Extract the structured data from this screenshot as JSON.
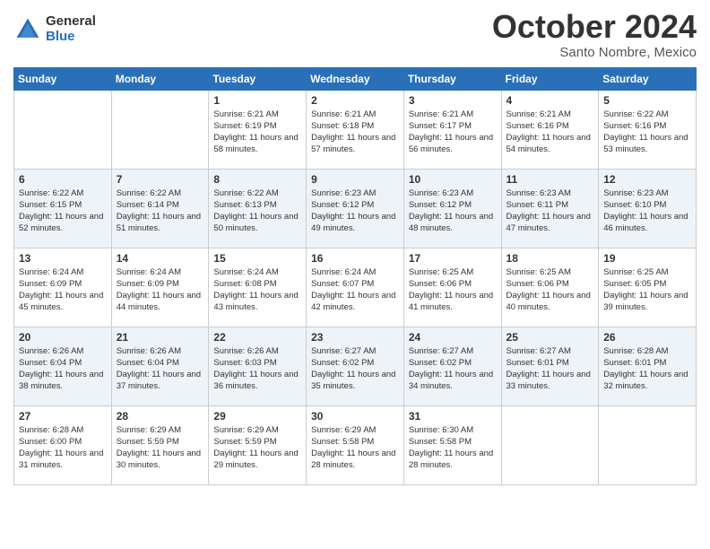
{
  "header": {
    "logo_general": "General",
    "logo_blue": "Blue",
    "month_title": "October 2024",
    "subtitle": "Santo Nombre, Mexico"
  },
  "weekdays": [
    "Sunday",
    "Monday",
    "Tuesday",
    "Wednesday",
    "Thursday",
    "Friday",
    "Saturday"
  ],
  "weeks": [
    [
      {
        "day": "",
        "info": ""
      },
      {
        "day": "",
        "info": ""
      },
      {
        "day": "1",
        "info": "Sunrise: 6:21 AM\nSunset: 6:19 PM\nDaylight: 11 hours and 58 minutes."
      },
      {
        "day": "2",
        "info": "Sunrise: 6:21 AM\nSunset: 6:18 PM\nDaylight: 11 hours and 57 minutes."
      },
      {
        "day": "3",
        "info": "Sunrise: 6:21 AM\nSunset: 6:17 PM\nDaylight: 11 hours and 56 minutes."
      },
      {
        "day": "4",
        "info": "Sunrise: 6:21 AM\nSunset: 6:16 PM\nDaylight: 11 hours and 54 minutes."
      },
      {
        "day": "5",
        "info": "Sunrise: 6:22 AM\nSunset: 6:16 PM\nDaylight: 11 hours and 53 minutes."
      }
    ],
    [
      {
        "day": "6",
        "info": "Sunrise: 6:22 AM\nSunset: 6:15 PM\nDaylight: 11 hours and 52 minutes."
      },
      {
        "day": "7",
        "info": "Sunrise: 6:22 AM\nSunset: 6:14 PM\nDaylight: 11 hours and 51 minutes."
      },
      {
        "day": "8",
        "info": "Sunrise: 6:22 AM\nSunset: 6:13 PM\nDaylight: 11 hours and 50 minutes."
      },
      {
        "day": "9",
        "info": "Sunrise: 6:23 AM\nSunset: 6:12 PM\nDaylight: 11 hours and 49 minutes."
      },
      {
        "day": "10",
        "info": "Sunrise: 6:23 AM\nSunset: 6:12 PM\nDaylight: 11 hours and 48 minutes."
      },
      {
        "day": "11",
        "info": "Sunrise: 6:23 AM\nSunset: 6:11 PM\nDaylight: 11 hours and 47 minutes."
      },
      {
        "day": "12",
        "info": "Sunrise: 6:23 AM\nSunset: 6:10 PM\nDaylight: 11 hours and 46 minutes."
      }
    ],
    [
      {
        "day": "13",
        "info": "Sunrise: 6:24 AM\nSunset: 6:09 PM\nDaylight: 11 hours and 45 minutes."
      },
      {
        "day": "14",
        "info": "Sunrise: 6:24 AM\nSunset: 6:09 PM\nDaylight: 11 hours and 44 minutes."
      },
      {
        "day": "15",
        "info": "Sunrise: 6:24 AM\nSunset: 6:08 PM\nDaylight: 11 hours and 43 minutes."
      },
      {
        "day": "16",
        "info": "Sunrise: 6:24 AM\nSunset: 6:07 PM\nDaylight: 11 hours and 42 minutes."
      },
      {
        "day": "17",
        "info": "Sunrise: 6:25 AM\nSunset: 6:06 PM\nDaylight: 11 hours and 41 minutes."
      },
      {
        "day": "18",
        "info": "Sunrise: 6:25 AM\nSunset: 6:06 PM\nDaylight: 11 hours and 40 minutes."
      },
      {
        "day": "19",
        "info": "Sunrise: 6:25 AM\nSunset: 6:05 PM\nDaylight: 11 hours and 39 minutes."
      }
    ],
    [
      {
        "day": "20",
        "info": "Sunrise: 6:26 AM\nSunset: 6:04 PM\nDaylight: 11 hours and 38 minutes."
      },
      {
        "day": "21",
        "info": "Sunrise: 6:26 AM\nSunset: 6:04 PM\nDaylight: 11 hours and 37 minutes."
      },
      {
        "day": "22",
        "info": "Sunrise: 6:26 AM\nSunset: 6:03 PM\nDaylight: 11 hours and 36 minutes."
      },
      {
        "day": "23",
        "info": "Sunrise: 6:27 AM\nSunset: 6:02 PM\nDaylight: 11 hours and 35 minutes."
      },
      {
        "day": "24",
        "info": "Sunrise: 6:27 AM\nSunset: 6:02 PM\nDaylight: 11 hours and 34 minutes."
      },
      {
        "day": "25",
        "info": "Sunrise: 6:27 AM\nSunset: 6:01 PM\nDaylight: 11 hours and 33 minutes."
      },
      {
        "day": "26",
        "info": "Sunrise: 6:28 AM\nSunset: 6:01 PM\nDaylight: 11 hours and 32 minutes."
      }
    ],
    [
      {
        "day": "27",
        "info": "Sunrise: 6:28 AM\nSunset: 6:00 PM\nDaylight: 11 hours and 31 minutes."
      },
      {
        "day": "28",
        "info": "Sunrise: 6:29 AM\nSunset: 5:59 PM\nDaylight: 11 hours and 30 minutes."
      },
      {
        "day": "29",
        "info": "Sunrise: 6:29 AM\nSunset: 5:59 PM\nDaylight: 11 hours and 29 minutes."
      },
      {
        "day": "30",
        "info": "Sunrise: 6:29 AM\nSunset: 5:58 PM\nDaylight: 11 hours and 28 minutes."
      },
      {
        "day": "31",
        "info": "Sunrise: 6:30 AM\nSunset: 5:58 PM\nDaylight: 11 hours and 28 minutes."
      },
      {
        "day": "",
        "info": ""
      },
      {
        "day": "",
        "info": ""
      }
    ]
  ]
}
